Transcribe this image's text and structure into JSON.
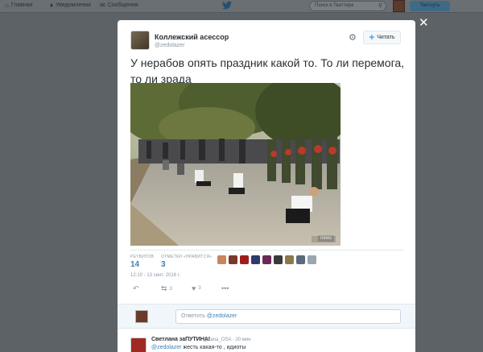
{
  "nav": {
    "home_label": "Главная",
    "notifications_label": "Уведомления",
    "messages_label": "Сообщения",
    "search_placeholder": "Поиск в Твиттере",
    "tweet_button_label": "Твитнуть"
  },
  "tweet": {
    "author_name": "Коллежский асессор",
    "author_handle": "@zedolazer",
    "follow_label": "Читать",
    "text": "У нерабов опять праздник какой то. То ли перемога, то ли зрада",
    "retweets_label": "РЕТВИТОВ",
    "retweets_count": "14",
    "likes_label": "ОТМЕТКИ «НРАВИТСЯ»",
    "likes_count": "3",
    "timestamp": "12:10 - 13 сент. 2016 г.",
    "retweet_action_count": "3",
    "like_action_count": "3",
    "photo_watermark": "news"
  },
  "reply_box": {
    "prefix": "Ответить ",
    "mention": "@zedolazer"
  },
  "reply": {
    "author_name": "Светлана заПУТИНА!",
    "author_handle": "@Lana_OSA · 20 мин",
    "mention": "@zedolazer",
    "text": " жесть какая-то , идиоты"
  },
  "colors": {
    "link": "#3f7fb3",
    "muted": "#8899a6",
    "overlay": "#5d6266"
  }
}
